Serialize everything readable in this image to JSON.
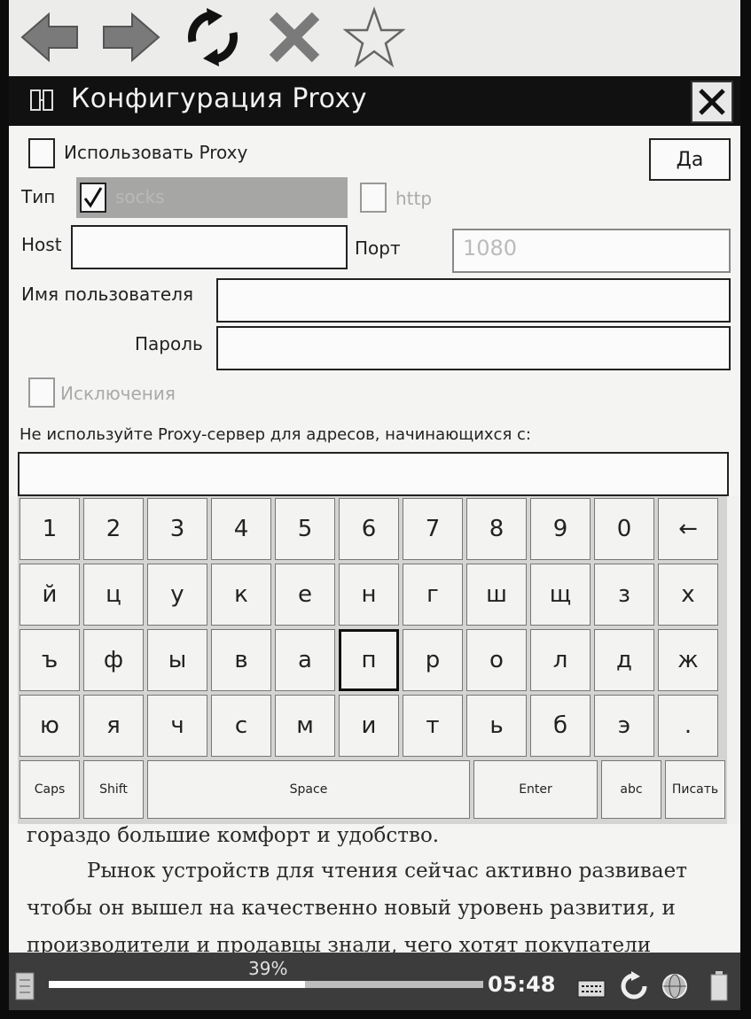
{
  "dialog": {
    "title": "Конфигурация Proxy",
    "use_proxy_label": "Использовать Proxy",
    "ok_label": "Да",
    "type_label": "Тип",
    "type_option_socks": "socks",
    "type_option_http": "http",
    "host_label": "Host",
    "host_value": "",
    "port_label": "Порт",
    "port_value": "1080",
    "username_label": "Имя пользователя",
    "username_value": "",
    "password_label": "Пароль",
    "password_value": "",
    "exceptions_label": "Исключения",
    "bypass_label": "Не используйте Proxy-сервер для адресов, начинающихся с:",
    "bypass_value": ""
  },
  "keyboard": {
    "rows": [
      [
        "1",
        "2",
        "3",
        "4",
        "5",
        "6",
        "7",
        "8",
        "9",
        "0",
        "←"
      ],
      [
        "й",
        "ц",
        "у",
        "к",
        "е",
        "н",
        "г",
        "ш",
        "щ",
        "з",
        "х"
      ],
      [
        "ъ",
        "ф",
        "ы",
        "в",
        "а",
        "п",
        "р",
        "о",
        "л",
        "д",
        "ж"
      ],
      [
        "ю",
        "я",
        "ч",
        "с",
        "м",
        "и",
        "т",
        "ь",
        "б",
        "э",
        "."
      ]
    ],
    "bottom": {
      "caps": "Caps",
      "shift": "Shift",
      "space": "Space",
      "enter": "Enter",
      "abc": "abc",
      "write": "Писать"
    },
    "selected_key": "п"
  },
  "reader": {
    "line1": "гораздо большие комфорт и удобство.",
    "line2": "Рынок устройств для чтения сейчас активно развивает",
    "line3": "чтобы он вышел на качественно новый уровень развития, и",
    "line4": "производители и продавцы знали, чего хотят покупатели"
  },
  "status": {
    "percent": "39%",
    "progress": 0.59,
    "time": "05:48"
  },
  "icons": {
    "back": "back-arrow-icon",
    "forward": "forward-arrow-icon",
    "refresh": "refresh-icon",
    "stop": "stop-icon",
    "bookmark": "star-icon"
  }
}
